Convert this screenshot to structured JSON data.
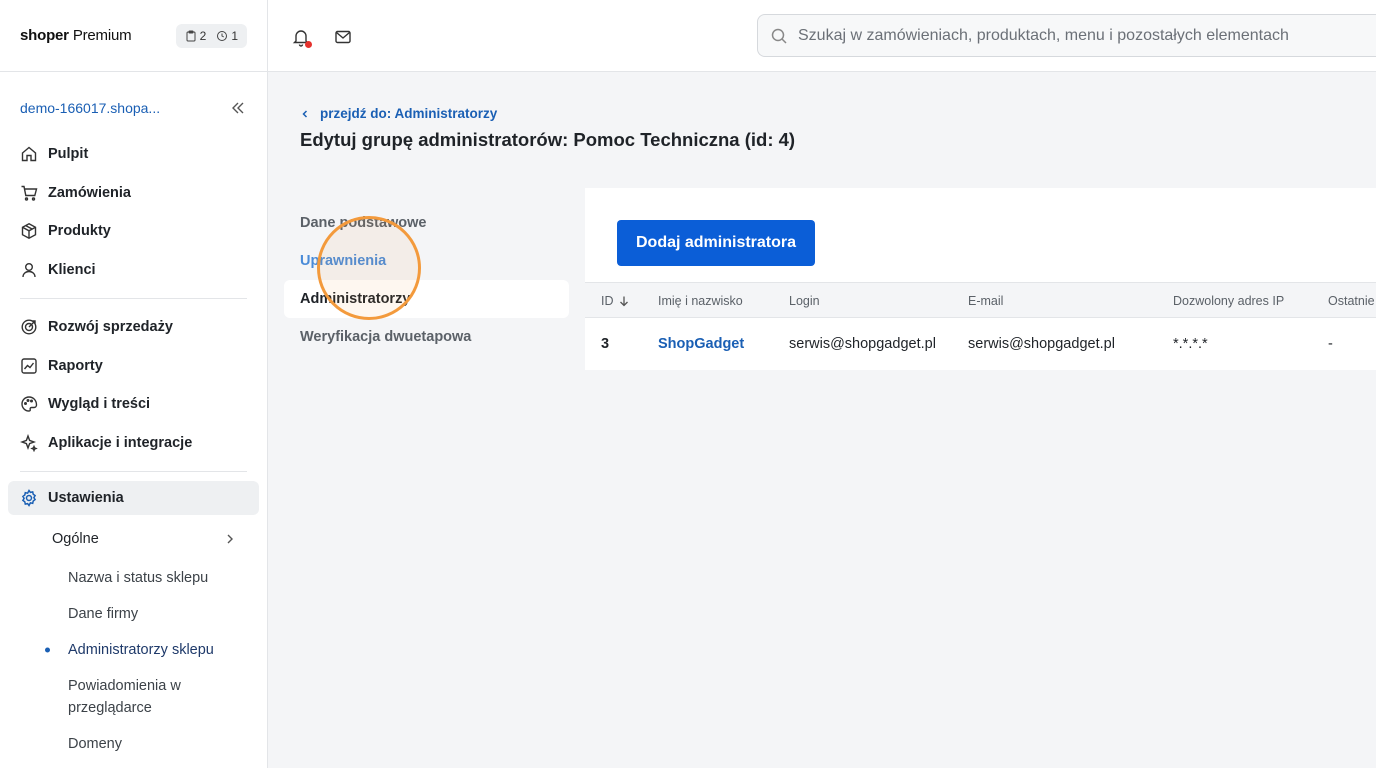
{
  "brand": {
    "name": "shoper",
    "plan": "Premium",
    "badge_tasks": "2",
    "badge_clock": "1"
  },
  "search": {
    "placeholder": "Szukaj w zamówieniach, produktach, menu i pozostałych elementach"
  },
  "sidebar": {
    "store": "demo-166017.shopa...",
    "items": [
      {
        "label": "Pulpit",
        "icon": "home-icon"
      },
      {
        "label": "Zamówienia",
        "icon": "cart-icon"
      },
      {
        "label": "Produkty",
        "icon": "box-icon"
      },
      {
        "label": "Klienci",
        "icon": "user-icon"
      },
      {
        "label": "Rozwój sprzedaży",
        "icon": "growth-icon"
      },
      {
        "label": "Raporty",
        "icon": "chart-icon"
      },
      {
        "label": "Wygląd i treści",
        "icon": "palette-icon"
      },
      {
        "label": "Aplikacje i integracje",
        "icon": "sparkle-icon"
      },
      {
        "label": "Ustawienia",
        "icon": "gear-icon"
      }
    ],
    "sub": {
      "label": "Ogólne"
    },
    "subsub": [
      "Nazwa i status sklepu",
      "Dane firmy",
      "Administratorzy sklepu",
      "Powiadomienia w przeglądarce",
      "Domeny"
    ]
  },
  "main": {
    "back_link": "przejdź do: Administratorzy",
    "title": "Edytuj grupę administratorów: Pomoc Techniczna (id: 4)",
    "subnav": [
      "Dane podstawowe",
      "Uprawnienia",
      "Administratorzy",
      "Weryfikacja dwuetapowa"
    ],
    "add_button": "Dodaj administratora",
    "table": {
      "headers": [
        "ID",
        "Imię i nazwisko",
        "Login",
        "E-mail",
        "Dozwolony adres IP",
        "Ostatnie"
      ],
      "rows": [
        [
          "3",
          "ShopGadget",
          "serwis@shopgadget.pl",
          "serwis@shopgadget.pl",
          "*.*.*.*",
          "-"
        ]
      ]
    }
  },
  "colors": {
    "primary": "#0b5ed7",
    "link": "#1a5fb4",
    "highlight": "#f39a3c",
    "notif": "#e5322d"
  }
}
